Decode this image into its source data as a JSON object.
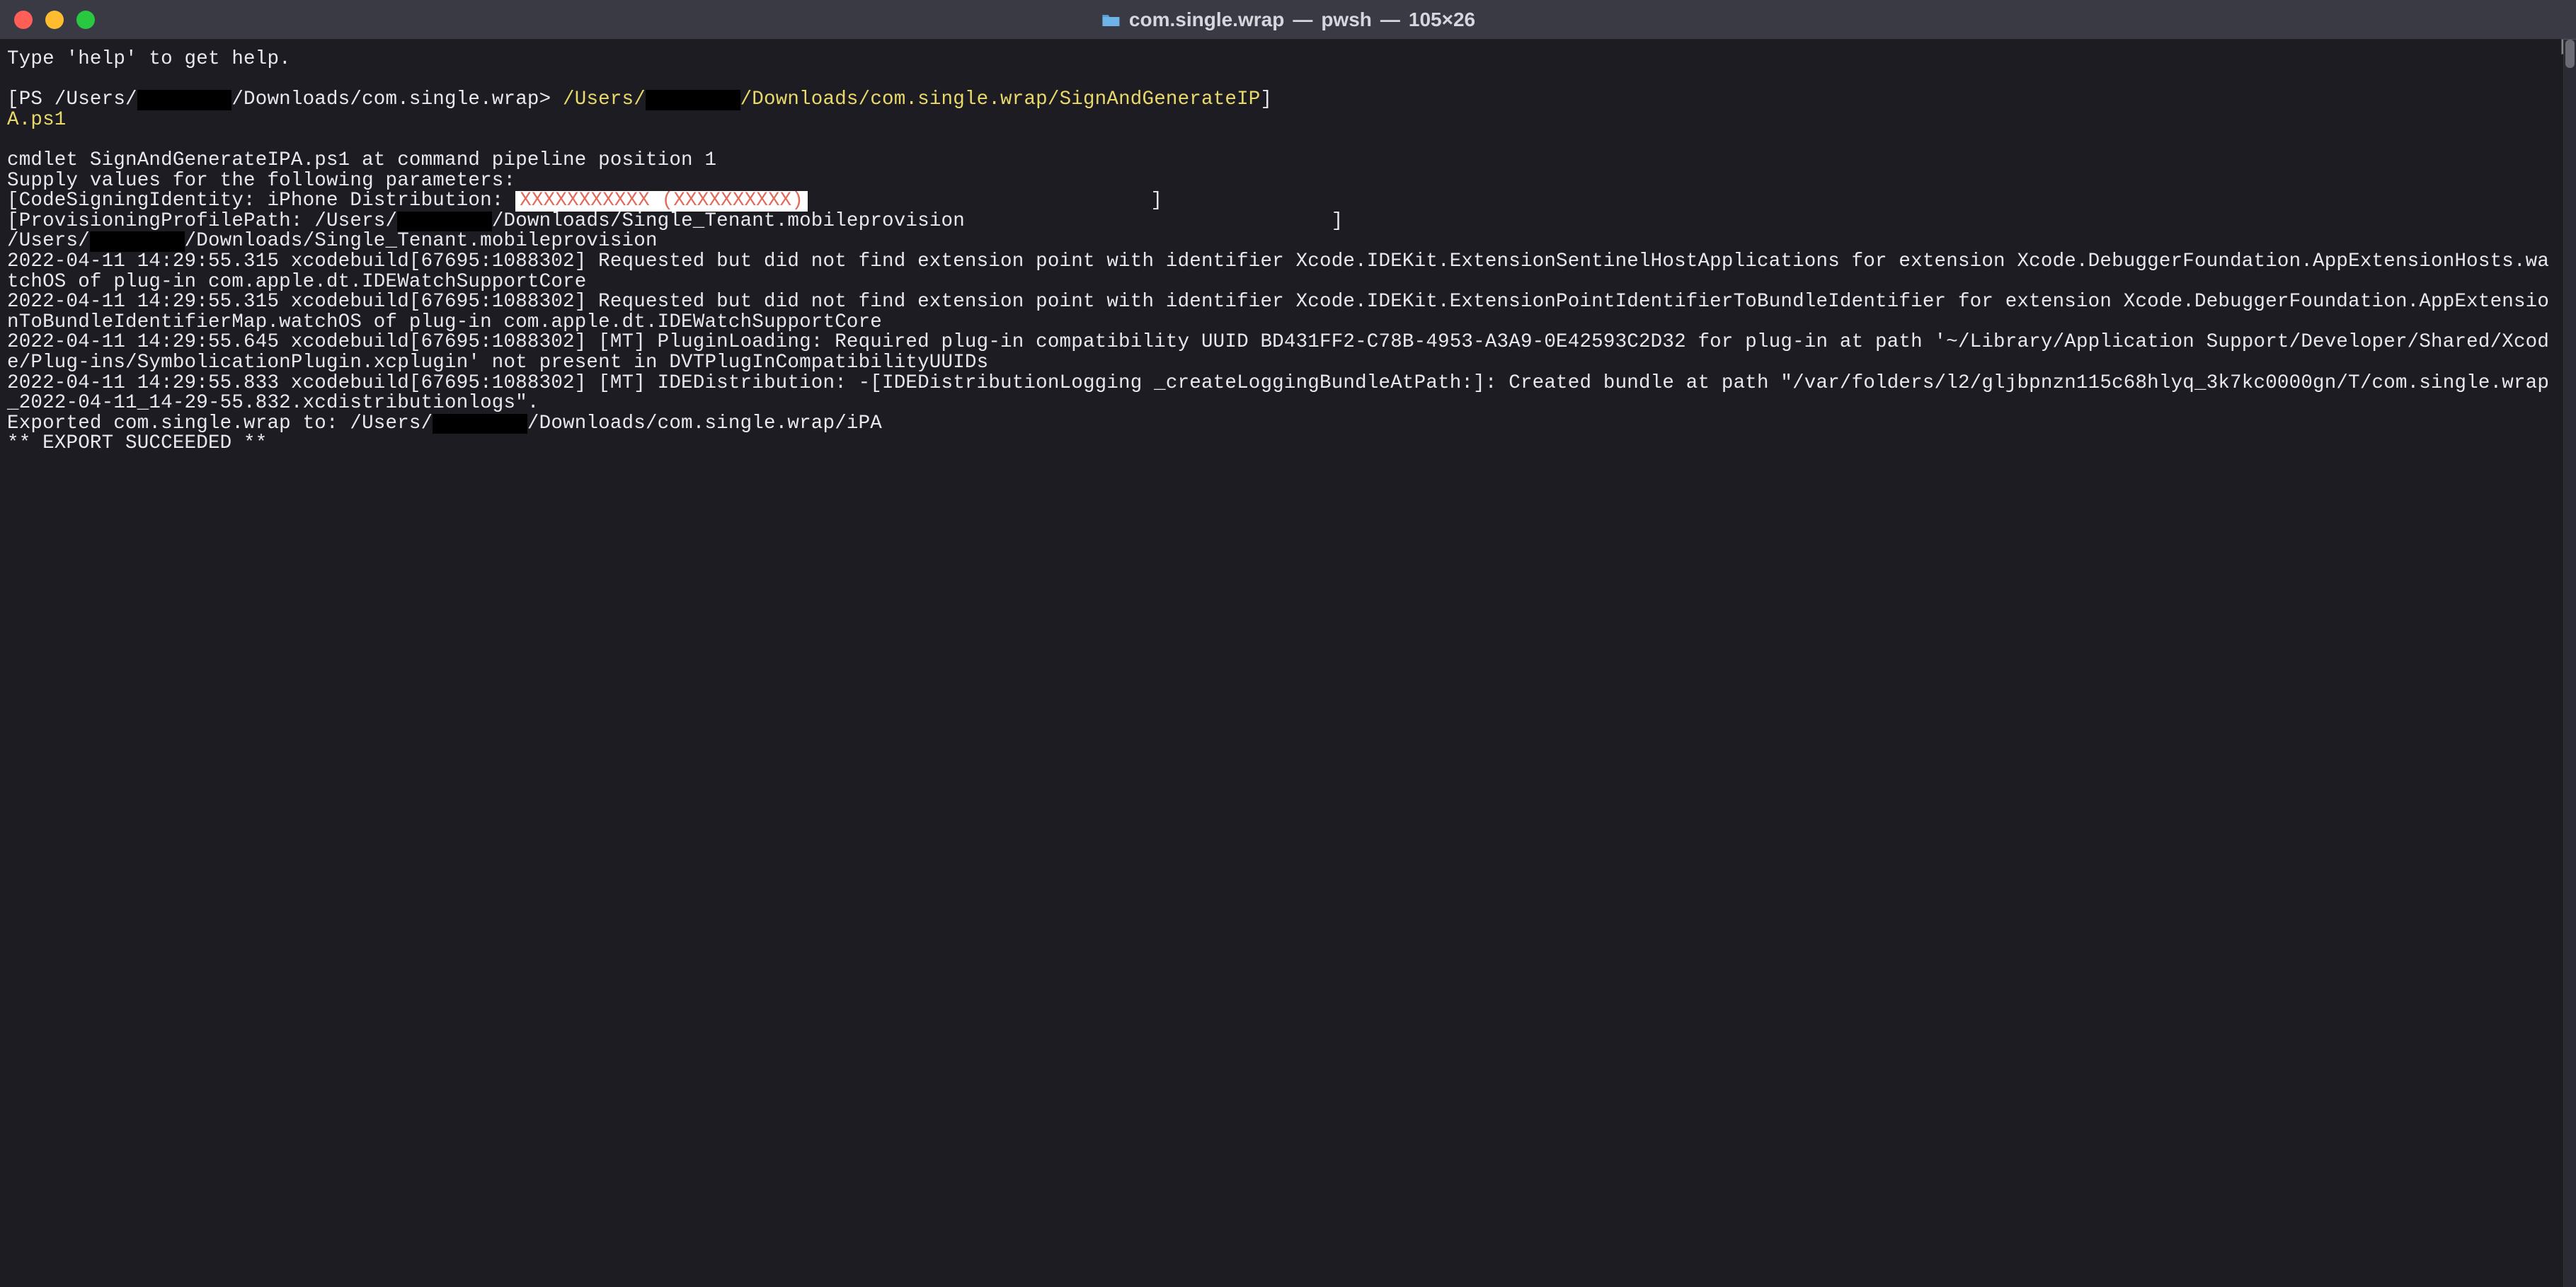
{
  "titlebar": {
    "close_label": "Close",
    "minimize_label": "Minimize",
    "zoom_label": "Zoom",
    "folder_name": "com.single.wrap",
    "separator": " — ",
    "process": "pwsh",
    "dimensions": "105×26"
  },
  "terminal": {
    "help_line": "Type 'help' to get help.",
    "blank": "",
    "prompt_open": "[",
    "prompt_ps": "PS /Users/",
    "redact_user_1": "        ",
    "prompt_path": "/Downloads/com.single.wrap> ",
    "cmd_prefix": "/Users/",
    "redact_user_2": "        ",
    "cmd_suffix_1": "/Downloads/com.single.wrap/SignAndGenerateIP",
    "prompt_close_1": "]",
    "cmd_suffix_2": "A.ps1",
    "cmdlet_line": "cmdlet SignAndGenerateIPA.ps1 at command pipeline position 1",
    "supply_line": "Supply values for the following parameters:",
    "csi_open": "[",
    "csi_label": "CodeSigningIdentity: iPhone Distribution: ",
    "csi_redact": "XXXXXXXXXXX (XXXXXXXXXX)",
    "csi_close": "]",
    "ppp_open": "[",
    "ppp_label": "ProvisioningProfilePath: /Users/",
    "redact_user_3": "        ",
    "ppp_path": "/Downloads/Single_Tenant.mobileprovision",
    "ppp_close": "]",
    "echo_prefix": "/Users/",
    "redact_user_4": "        ",
    "echo_suffix": "/Downloads/Single_Tenant.mobileprovision",
    "log1": "2022-04-11 14:29:55.315 xcodebuild[67695:1088302] Requested but did not find extension point with identifier Xcode.IDEKit.ExtensionSentinelHostApplications for extension Xcode.DebuggerFoundation.AppExtensionHosts.watchOS of plug-in com.apple.dt.IDEWatchSupportCore",
    "log2": "2022-04-11 14:29:55.315 xcodebuild[67695:1088302] Requested but did not find extension point with identifier Xcode.IDEKit.ExtensionPointIdentifierToBundleIdentifier for extension Xcode.DebuggerFoundation.AppExtensionToBundleIdentifierMap.watchOS of plug-in com.apple.dt.IDEWatchSupportCore",
    "log3": "2022-04-11 14:29:55.645 xcodebuild[67695:1088302] [MT] PluginLoading: Required plug-in compatibility UUID BD431FF2-C78B-4953-A3A9-0E42593C2D32 for plug-in at path '~/Library/Application Support/Developer/Shared/Xcode/Plug-ins/SymbolicationPlugin.xcplugin' not present in DVTPlugInCompatibilityUUIDs",
    "log4": "2022-04-11 14:29:55.833 xcodebuild[67695:1088302] [MT] IDEDistribution: -[IDEDistributionLogging _createLoggingBundleAtPath:]: Created bundle at path \"/var/folders/l2/gljbpnzn115c68hlyq_3k7kc0000gn/T/com.single.wrap_2022-04-11_14-29-55.832.xcdistributionlogs\".",
    "exported_prefix": "Exported com.single.wrap to: /Users/",
    "redact_user_5": "        ",
    "exported_suffix": "/Downloads/com.single.wrap/iPA",
    "succeeded": "** EXPORT SUCCEEDED **"
  }
}
